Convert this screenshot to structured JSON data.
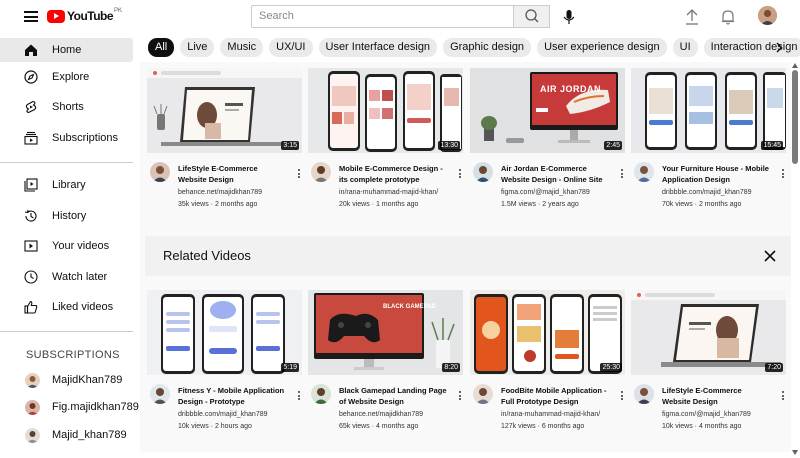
{
  "header": {
    "logo_text": "YouTube",
    "logo_region": "PK",
    "search_placeholder": "Search",
    "icons": [
      "menu-icon",
      "search-icon",
      "mic-icon",
      "upload-icon",
      "bell-icon"
    ]
  },
  "sidebar": {
    "items": [
      {
        "label": "Home",
        "icon": "home-icon",
        "active": true
      },
      {
        "label": "Explore",
        "icon": "compass-icon"
      },
      {
        "label": "Shorts",
        "icon": "shorts-icon"
      },
      {
        "label": "Subscriptions",
        "icon": "subscriptions-icon"
      },
      {
        "label": "Library",
        "icon": "library-icon"
      },
      {
        "label": "History",
        "icon": "history-icon"
      },
      {
        "label": "Your videos",
        "icon": "your-videos-icon"
      },
      {
        "label": "Watch later",
        "icon": "watch-later-icon"
      },
      {
        "label": "Liked videos",
        "icon": "like-icon"
      }
    ],
    "subscriptions_heading": "SUBSCRIPTIONS",
    "subscriptions": [
      {
        "label": "MajidKhan789"
      },
      {
        "label": "Fig.majidkhan789"
      },
      {
        "label": "Majid_khan789"
      }
    ]
  },
  "chips": [
    "All",
    "Live",
    "Music",
    "UX/UI",
    "User Interface design",
    "Graphic design",
    "User experience design",
    "UI",
    "Interaction design"
  ],
  "videos": [
    {
      "title": "LifeStyle E-Commerce Website Design",
      "channel": "behance.net/majidkhan789",
      "meta": "35k views · 2 months ago",
      "duration": "3:15"
    },
    {
      "title": "Mobile E-Commerce Design - its complete prototype",
      "channel": "in/rana-muhammad-majid-khan/",
      "meta": "20k views · 1 months ago",
      "duration": "13:30"
    },
    {
      "title": "Air Jordan E-Commerce Website Design - Online Site",
      "channel": "figma.com/@majid_khan789",
      "meta": "1.5M views · 2 years ago",
      "duration": "2:45",
      "thumb_text": "AIR JORDAN"
    },
    {
      "title": "Your Furniture House - Mobile Application Design",
      "channel": "dribbble.com/majid_khan789",
      "meta": "70k views · 2 months ago",
      "duration": "15:45"
    }
  ],
  "related": {
    "heading": "Related Videos",
    "videos": [
      {
        "title": "Fitness Y - Mobile Application Design - Prototype",
        "channel": "dribbble.com/majid_khan789",
        "meta": "10k views · 2 hours ago",
        "duration": "5:19"
      },
      {
        "title": "Black Gamepad Landing Page of Website Design",
        "channel": "behance.net/majidkhan789",
        "meta": "65k views · 4 months ago",
        "duration": "8:20",
        "thumb_text": "BLACK GAMEPAD"
      },
      {
        "title": "FoodBite Mobile Application - Full Prototype Design",
        "channel": "in/rana-muhammad-majid-khan/",
        "meta": "127k views · 6 months ago",
        "duration": "25:30"
      },
      {
        "title": "LifeStyle E-Commerce Website Design",
        "channel": "figma.com/@majid_khan789",
        "meta": "10k views · 4 months ago",
        "duration": "7:20"
      }
    ]
  }
}
